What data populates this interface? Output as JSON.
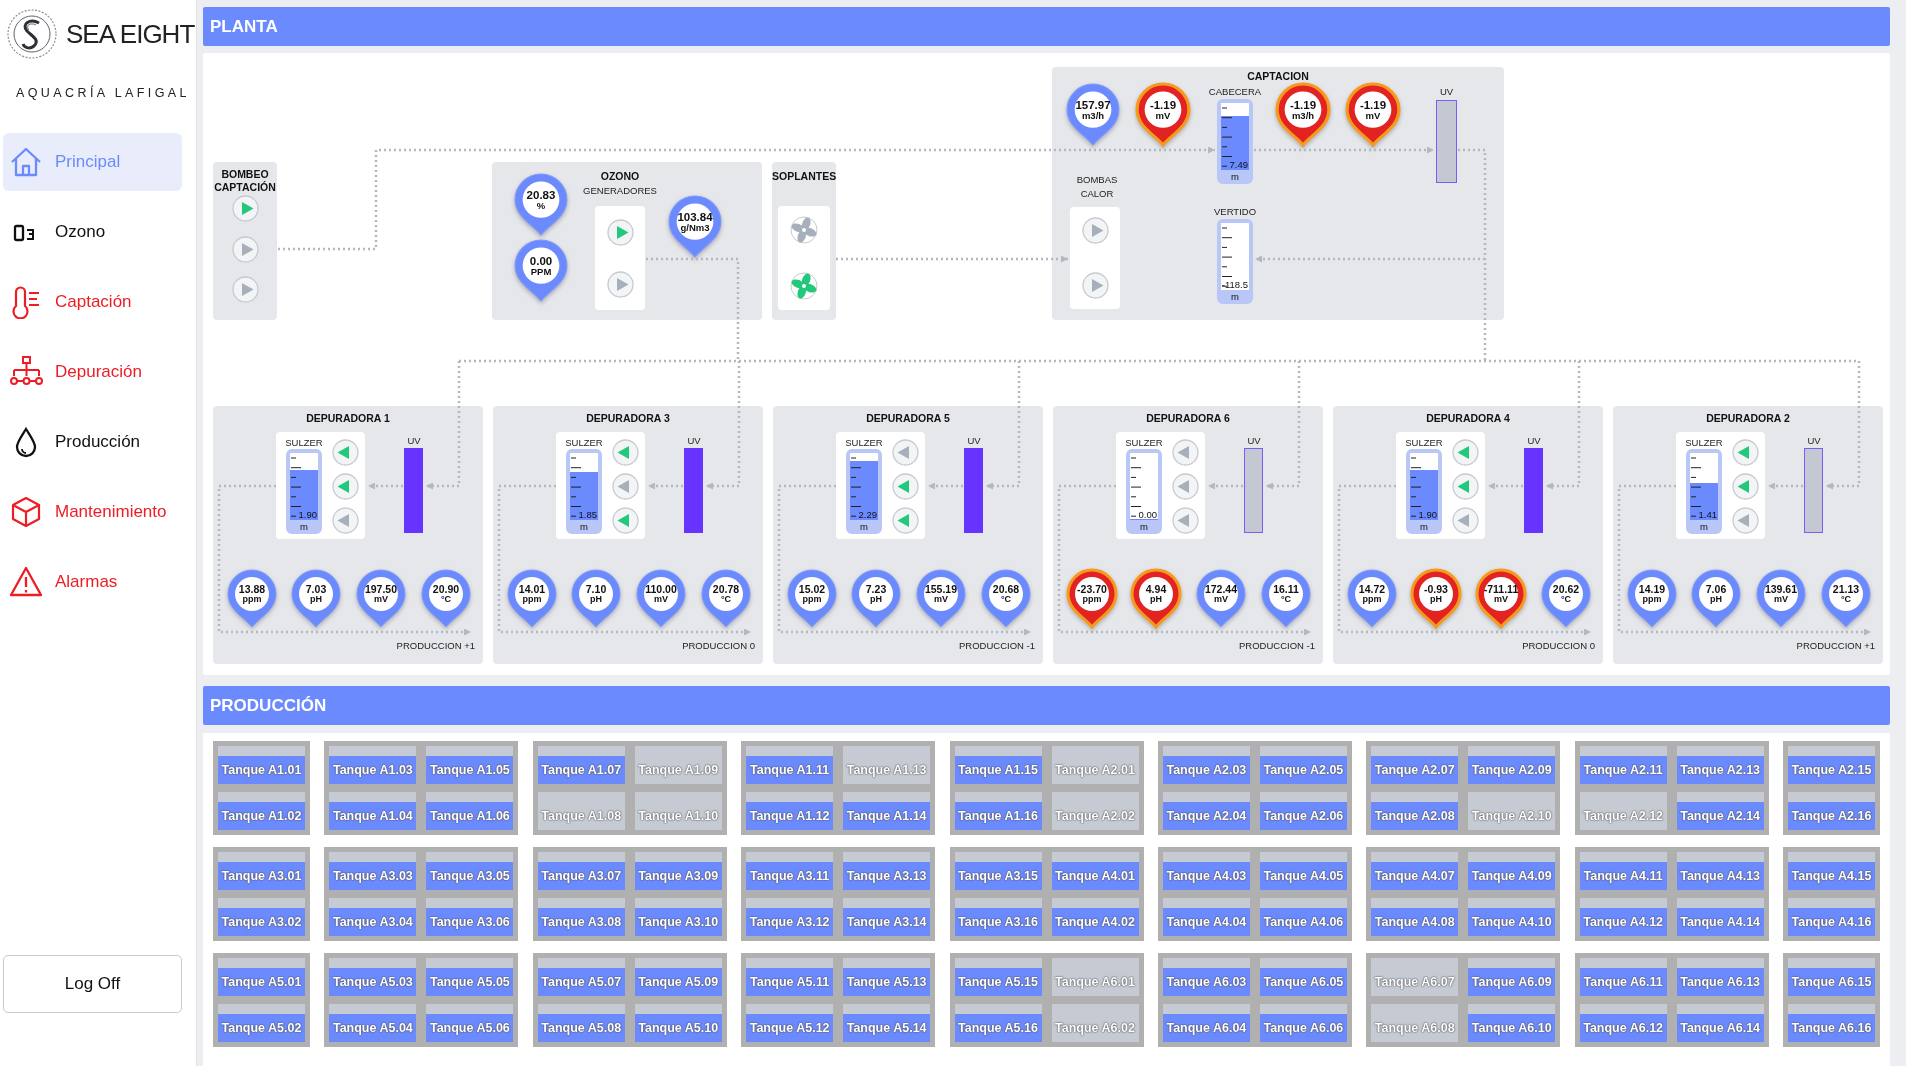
{
  "sidebar": {
    "brand": "SEA EIGHT",
    "subtitle": "AQUACRÍA LAFIGAL",
    "items": [
      {
        "label": "Principal",
        "selected": true,
        "alarm": false
      },
      {
        "label": "Ozono",
        "selected": false,
        "alarm": false
      },
      {
        "label": "Captación",
        "selected": false,
        "alarm": true
      },
      {
        "label": "Depuración",
        "selected": false,
        "alarm": true
      },
      {
        "label": "Producción",
        "selected": false,
        "alarm": false
      },
      {
        "label": "Mantenimiento",
        "selected": false,
        "alarm": true
      },
      {
        "label": "Alarmas",
        "selected": false,
        "alarm": true
      }
    ],
    "logoff": "Log Off"
  },
  "planta": {
    "title": "PLANTA",
    "bombeo": {
      "title": "BOMBEO CAPTACIÓN",
      "pumps": [
        {
          "on": true
        },
        {
          "on": false
        },
        {
          "on": false
        }
      ]
    },
    "ozono": {
      "title": "OZONO",
      "subtitle": "GENERADORES",
      "gauges": [
        {
          "value": "20.83",
          "unit": "%",
          "alarm": false
        },
        {
          "value": "0.00",
          "unit": "PPM",
          "alarm": false
        },
        {
          "value": "103.84",
          "unit": "g/Nm3",
          "alarm": false
        }
      ],
      "pumps": [
        {
          "on": true
        },
        {
          "on": false
        }
      ]
    },
    "soplantes": {
      "title": "SOPLANTES",
      "fans": [
        {
          "on": false
        },
        {
          "on": true
        }
      ]
    },
    "captacion": {
      "title": "CAPTACION",
      "gauges": [
        {
          "value": "157.97",
          "unit": "m3/h",
          "alarm": false
        },
        {
          "value": "-1.19",
          "unit": "mV",
          "alarm": true
        },
        {
          "value": "-1.19",
          "unit": "m3/h",
          "alarm": true
        },
        {
          "value": "-1.19",
          "unit": "mV",
          "alarm": true
        }
      ],
      "cabecera": {
        "label": "CABECERA",
        "value": "7.49",
        "unit": "m",
        "level": 0.8
      },
      "uv": {
        "label": "UV",
        "on": false
      },
      "bombas": {
        "title": "BOMBAS CALOR",
        "pumps": [
          {
            "on": false
          },
          {
            "on": false
          }
        ]
      },
      "vertido": {
        "label": "VERTIDO",
        "value": "-118.5",
        "unit": "m",
        "level": 0
      }
    },
    "depuradoras": [
      {
        "title": "DEPURADORA 1",
        "sulzer": {
          "label": "SULZER",
          "value": "1.90",
          "unit": "m",
          "level": 0.75
        },
        "pumps": [
          {
            "on": true
          },
          {
            "on": true
          },
          {
            "on": false
          }
        ],
        "uv": {
          "label": "UV",
          "on": true
        },
        "gauges": [
          {
            "value": "13.88",
            "unit": "ppm",
            "alarm": false
          },
          {
            "value": "7.03",
            "unit": "pH",
            "alarm": false
          },
          {
            "value": "197.50",
            "unit": "mV",
            "alarm": false
          },
          {
            "value": "20.90",
            "unit": "°C",
            "alarm": false
          }
        ],
        "destino": "PRODUCCION +1"
      },
      {
        "title": "DEPURADORA 3",
        "sulzer": {
          "label": "SULZER",
          "value": "1.85",
          "unit": "m",
          "level": 0.72
        },
        "pumps": [
          {
            "on": true
          },
          {
            "on": false
          },
          {
            "on": true
          }
        ],
        "uv": {
          "label": "UV",
          "on": true
        },
        "gauges": [
          {
            "value": "14.01",
            "unit": "ppm",
            "alarm": false
          },
          {
            "value": "7.10",
            "unit": "pH",
            "alarm": false
          },
          {
            "value": "110.00",
            "unit": "mV",
            "alarm": false
          },
          {
            "value": "20.78",
            "unit": "°C",
            "alarm": false
          }
        ],
        "destino": "PRODUCCION 0"
      },
      {
        "title": "DEPURADORA 5",
        "sulzer": {
          "label": "SULZER",
          "value": "2.29",
          "unit": "m",
          "level": 0.88
        },
        "pumps": [
          {
            "on": false
          },
          {
            "on": true
          },
          {
            "on": true
          }
        ],
        "uv": {
          "label": "UV",
          "on": true
        },
        "gauges": [
          {
            "value": "15.02",
            "unit": "ppm",
            "alarm": false
          },
          {
            "value": "7.23",
            "unit": "pH",
            "alarm": false
          },
          {
            "value": "155.19",
            "unit": "mV",
            "alarm": false
          },
          {
            "value": "20.68",
            "unit": "°C",
            "alarm": false
          }
        ],
        "destino": "PRODUCCION -1"
      },
      {
        "title": "DEPURADORA 6",
        "sulzer": {
          "label": "SULZER",
          "value": "0.00",
          "unit": "m",
          "level": 0.02
        },
        "pumps": [
          {
            "on": false
          },
          {
            "on": false
          },
          {
            "on": false
          }
        ],
        "uv": {
          "label": "UV",
          "on": false
        },
        "gauges": [
          {
            "value": "-23.70",
            "unit": "ppm",
            "alarm": true
          },
          {
            "value": "4.94",
            "unit": "pH",
            "alarm": true
          },
          {
            "value": "172.44",
            "unit": "mV",
            "alarm": false
          },
          {
            "value": "16.11",
            "unit": "°C",
            "alarm": false
          }
        ],
        "destino": "PRODUCCION -1"
      },
      {
        "title": "DEPURADORA 4",
        "sulzer": {
          "label": "SULZER",
          "value": "1.90",
          "unit": "m",
          "level": 0.75
        },
        "pumps": [
          {
            "on": true
          },
          {
            "on": true
          },
          {
            "on": false
          }
        ],
        "uv": {
          "label": "UV",
          "on": true
        },
        "gauges": [
          {
            "value": "14.72",
            "unit": "ppm",
            "alarm": false
          },
          {
            "value": "-0.93",
            "unit": "pH",
            "alarm": true
          },
          {
            "value": "-711.11",
            "unit": "mV",
            "alarm": true
          },
          {
            "value": "20.62",
            "unit": "°C",
            "alarm": false
          }
        ],
        "destino": "PRODUCCION 0"
      },
      {
        "title": "DEPURADORA 2",
        "sulzer": {
          "label": "SULZER",
          "value": "1.41",
          "unit": "m",
          "level": 0.55
        },
        "pumps": [
          {
            "on": true
          },
          {
            "on": true
          },
          {
            "on": false
          }
        ],
        "uv": {
          "label": "UV",
          "on": false
        },
        "gauges": [
          {
            "value": "14.19",
            "unit": "ppm",
            "alarm": false
          },
          {
            "value": "7.06",
            "unit": "pH",
            "alarm": false
          },
          {
            "value": "139.61",
            "unit": "mV",
            "alarm": false
          },
          {
            "value": "21.13",
            "unit": "°C",
            "alarm": false
          }
        ],
        "destino": "PRODUCCION +1"
      }
    ]
  },
  "produccion": {
    "title": "PRODUCCIÓN",
    "blocks": [
      {
        "groups": [
          {
            "tanks": [
              {
                "label": "Tanque A1.01",
                "filled": true
              },
              {
                "label": "Tanque A1.02",
                "filled": true
              }
            ]
          },
          {
            "tanks": [
              {
                "label": "Tanque A1.03",
                "filled": true
              },
              {
                "label": "Tanque A1.04",
                "filled": true
              },
              {
                "label": "Tanque A1.05",
                "filled": true
              },
              {
                "label": "Tanque A1.06",
                "filled": true
              }
            ]
          },
          {
            "tanks": [
              {
                "label": "Tanque A1.07",
                "filled": true
              },
              {
                "label": "Tanque A1.08",
                "filled": false
              },
              {
                "label": "Tanque A1.09",
                "filled": false
              },
              {
                "label": "Tanque A1.10",
                "filled": false
              }
            ]
          },
          {
            "tanks": [
              {
                "label": "Tanque A1.11",
                "filled": true
              },
              {
                "label": "Tanque A1.12",
                "filled": true
              },
              {
                "label": "Tanque A1.13",
                "filled": false
              },
              {
                "label": "Tanque A1.14",
                "filled": true
              }
            ]
          },
          {
            "tanks": [
              {
                "label": "Tanque A1.15",
                "filled": true
              },
              {
                "label": "Tanque A1.16",
                "filled": true
              },
              {
                "label": "Tanque A2.01",
                "filled": false
              },
              {
                "label": "Tanque A2.02",
                "filled": false
              }
            ]
          },
          {
            "tanks": [
              {
                "label": "Tanque A2.03",
                "filled": true
              },
              {
                "label": "Tanque A2.04",
                "filled": true
              },
              {
                "label": "Tanque A2.05",
                "filled": true
              },
              {
                "label": "Tanque A2.06",
                "filled": true
              }
            ]
          },
          {
            "tanks": [
              {
                "label": "Tanque A2.07",
                "filled": true
              },
              {
                "label": "Tanque A2.08",
                "filled": true
              },
              {
                "label": "Tanque A2.09",
                "filled": true
              },
              {
                "label": "Tanque A2.10",
                "filled": false
              }
            ]
          },
          {
            "tanks": [
              {
                "label": "Tanque A2.11",
                "filled": true
              },
              {
                "label": "Tanque A2.12",
                "filled": false
              },
              {
                "label": "Tanque A2.13",
                "filled": true
              },
              {
                "label": "Tanque A2.14",
                "filled": true
              }
            ]
          },
          {
            "tanks": [
              {
                "label": "Tanque A2.15",
                "filled": true
              },
              {
                "label": "Tanque A2.16",
                "filled": true
              }
            ]
          }
        ]
      },
      {
        "groups": [
          {
            "tanks": [
              {
                "label": "Tanque A3.01",
                "filled": true
              },
              {
                "label": "Tanque A3.02",
                "filled": true
              }
            ]
          },
          {
            "tanks": [
              {
                "label": "Tanque A3.03",
                "filled": true
              },
              {
                "label": "Tanque A3.04",
                "filled": true
              },
              {
                "label": "Tanque A3.05",
                "filled": true
              },
              {
                "label": "Tanque A3.06",
                "filled": true
              }
            ]
          },
          {
            "tanks": [
              {
                "label": "Tanque A3.07",
                "filled": true
              },
              {
                "label": "Tanque A3.08",
                "filled": true
              },
              {
                "label": "Tanque A3.09",
                "filled": true
              },
              {
                "label": "Tanque A3.10",
                "filled": true
              }
            ]
          },
          {
            "tanks": [
              {
                "label": "Tanque A3.11",
                "filled": true
              },
              {
                "label": "Tanque A3.12",
                "filled": true
              },
              {
                "label": "Tanque A3.13",
                "filled": true
              },
              {
                "label": "Tanque A3.14",
                "filled": true
              }
            ]
          },
          {
            "tanks": [
              {
                "label": "Tanque A3.15",
                "filled": true
              },
              {
                "label": "Tanque A3.16",
                "filled": true
              },
              {
                "label": "Tanque A4.01",
                "filled": true
              },
              {
                "label": "Tanque A4.02",
                "filled": true
              }
            ]
          },
          {
            "tanks": [
              {
                "label": "Tanque A4.03",
                "filled": true
              },
              {
                "label": "Tanque A4.04",
                "filled": true
              },
              {
                "label": "Tanque A4.05",
                "filled": true
              },
              {
                "label": "Tanque A4.06",
                "filled": true
              }
            ]
          },
          {
            "tanks": [
              {
                "label": "Tanque A4.07",
                "filled": true
              },
              {
                "label": "Tanque A4.08",
                "filled": true
              },
              {
                "label": "Tanque A4.09",
                "filled": true
              },
              {
                "label": "Tanque A4.10",
                "filled": true
              }
            ]
          },
          {
            "tanks": [
              {
                "label": "Tanque A4.11",
                "filled": true
              },
              {
                "label": "Tanque A4.12",
                "filled": true
              },
              {
                "label": "Tanque A4.13",
                "filled": true
              },
              {
                "label": "Tanque A4.14",
                "filled": true
              }
            ]
          },
          {
            "tanks": [
              {
                "label": "Tanque A4.15",
                "filled": true
              },
              {
                "label": "Tanque A4.16",
                "filled": true
              }
            ]
          }
        ]
      },
      {
        "groups": [
          {
            "tanks": [
              {
                "label": "Tanque A5.01",
                "filled": true
              },
              {
                "label": "Tanque A5.02",
                "filled": true
              }
            ]
          },
          {
            "tanks": [
              {
                "label": "Tanque A5.03",
                "filled": true
              },
              {
                "label": "Tanque A5.04",
                "filled": true
              },
              {
                "label": "Tanque A5.05",
                "filled": true
              },
              {
                "label": "Tanque A5.06",
                "filled": true
              }
            ]
          },
          {
            "tanks": [
              {
                "label": "Tanque A5.07",
                "filled": true
              },
              {
                "label": "Tanque A5.08",
                "filled": true
              },
              {
                "label": "Tanque A5.09",
                "filled": true
              },
              {
                "label": "Tanque A5.10",
                "filled": true
              }
            ]
          },
          {
            "tanks": [
              {
                "label": "Tanque A5.11",
                "filled": true
              },
              {
                "label": "Tanque A5.12",
                "filled": true
              },
              {
                "label": "Tanque A5.13",
                "filled": true
              },
              {
                "label": "Tanque A5.14",
                "filled": true
              }
            ]
          },
          {
            "tanks": [
              {
                "label": "Tanque A5.15",
                "filled": true
              },
              {
                "label": "Tanque A5.16",
                "filled": true
              },
              {
                "label": "Tanque A6.01",
                "filled": false
              },
              {
                "label": "Tanque A6.02",
                "filled": false
              }
            ]
          },
          {
            "tanks": [
              {
                "label": "Tanque A6.03",
                "filled": true
              },
              {
                "label": "Tanque A6.04",
                "filled": true
              },
              {
                "label": "Tanque A6.05",
                "filled": true
              },
              {
                "label": "Tanque A6.06",
                "filled": true
              }
            ]
          },
          {
            "tanks": [
              {
                "label": "Tanque A6.07",
                "filled": false
              },
              {
                "label": "Tanque A6.08",
                "filled": false
              },
              {
                "label": "Tanque A6.09",
                "filled": true
              },
              {
                "label": "Tanque A6.10",
                "filled": true
              }
            ]
          },
          {
            "tanks": [
              {
                "label": "Tanque A6.11",
                "filled": true
              },
              {
                "label": "Tanque A6.12",
                "filled": true
              },
              {
                "label": "Tanque A6.13",
                "filled": true
              },
              {
                "label": "Tanque A6.14",
                "filled": true
              }
            ]
          },
          {
            "tanks": [
              {
                "label": "Tanque A6.15",
                "filled": true
              },
              {
                "label": "Tanque A6.16",
                "filled": true
              }
            ]
          }
        ]
      }
    ]
  }
}
